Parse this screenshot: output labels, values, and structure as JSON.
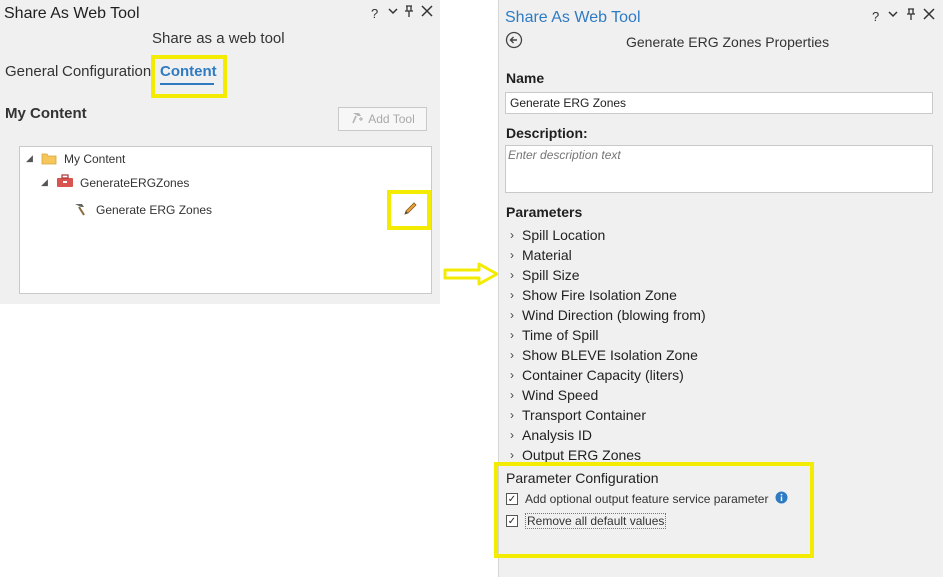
{
  "left": {
    "title": "Share As Web Tool",
    "subtitle": "Share as a web tool",
    "tabs": [
      "General",
      "Configuration",
      "Content"
    ],
    "section_title": "My Content",
    "add_tool_label": "Add Tool",
    "tree": {
      "root": "My Content",
      "toolbox": "GenerateERGZones",
      "tool": "Generate ERG Zones"
    },
    "window_controls": [
      "?",
      "⌄",
      "⊥",
      "✕"
    ]
  },
  "right": {
    "title": "Share As Web Tool",
    "subtitle": "Generate ERG Zones Properties",
    "name_label": "Name",
    "name_value": "Generate ERG Zones",
    "description_label": "Description:",
    "description_placeholder": "Enter description text",
    "parameters_label": "Parameters",
    "parameters": [
      "Spill Location",
      "Material",
      "Spill Size",
      "Show Fire Isolation Zone",
      "Wind Direction (blowing from)",
      "Time of Spill",
      "Show BLEVE Isolation Zone",
      "Container Capacity (liters)",
      "Wind Speed",
      "Transport Container",
      "Analysis ID",
      "Output ERG Zones"
    ],
    "config_label": "Parameter Configuration",
    "config_options": [
      {
        "label": "Add optional output feature service parameter",
        "checked": true
      },
      {
        "label": "Remove all default values",
        "checked": true
      }
    ],
    "window_controls": [
      "?",
      "⌄",
      "⊥",
      "✕"
    ]
  },
  "colors": {
    "highlight": "#f3eb00",
    "accent_blue": "#2e7bc4",
    "pane_bg": "#f0f0f0"
  }
}
